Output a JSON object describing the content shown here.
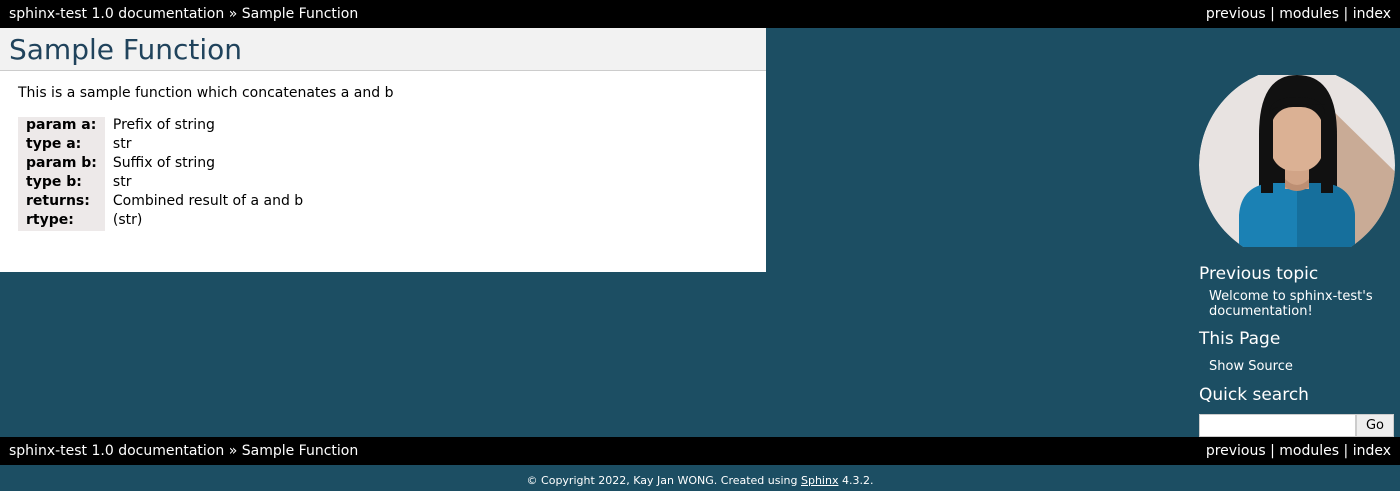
{
  "relbar": {
    "project_link": "sphinx-test 1.0 documentation",
    "sep": "»",
    "current_page": "Sample Function",
    "nav": {
      "previous": "previous",
      "modules": "modules",
      "index": "index"
    },
    "divider": "|"
  },
  "page": {
    "title": "Sample Function",
    "description": "This is a sample function which concatenates a and b",
    "fields": [
      {
        "name": "param a:",
        "value": "Prefix of string"
      },
      {
        "name": "type a:",
        "value": "str"
      },
      {
        "name": "param b:",
        "value": "Suffix of string"
      },
      {
        "name": "type b:",
        "value": "str"
      },
      {
        "name": "returns:",
        "value": "Combined result of a and b"
      },
      {
        "name": "rtype:",
        "value": "(str)"
      }
    ]
  },
  "sidebar": {
    "avatar_icon": "person-avatar-icon",
    "previous_topic": {
      "heading": "Previous topic",
      "link": "Welcome to sphinx-test's documentation!"
    },
    "this_page": {
      "heading": "This Page",
      "link": "Show Source"
    },
    "quick_search": {
      "heading": "Quick search",
      "input_value": "",
      "button": "Go"
    }
  },
  "footer": {
    "prefix": "© Copyright 2022, Kay Jan WONG. Created using ",
    "sphinx_link": "Sphinx",
    "suffix": " 4.3.2."
  },
  "colors": {
    "background": "#1c4e63",
    "relbar": "#000000",
    "title": "#20435c",
    "field_header": "#ede9e9"
  }
}
